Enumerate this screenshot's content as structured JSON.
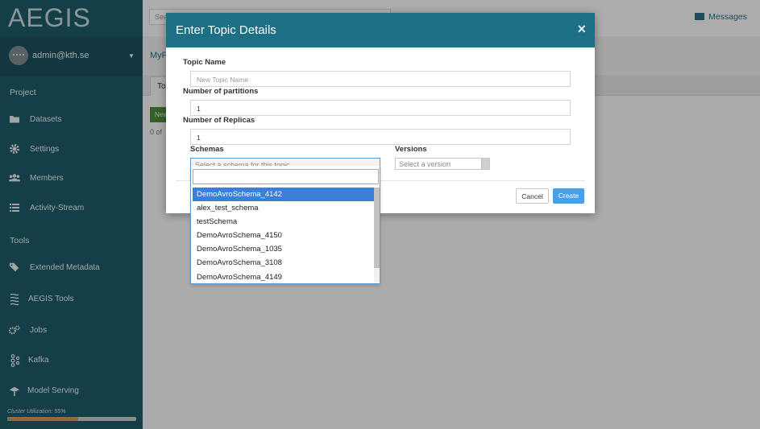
{
  "sidebar": {
    "brand": "AEGIS",
    "user": "admin@kth.se",
    "project_section": "Project",
    "project_items": [
      {
        "label": "Datasets",
        "icon": "folder-icon"
      },
      {
        "label": "Settings",
        "icon": "gear-icon"
      },
      {
        "label": "Members",
        "icon": "users-icon"
      },
      {
        "label": "Activity-Stream",
        "icon": "list-icon"
      }
    ],
    "tools_section": "Tools",
    "tools_items": [
      {
        "label": "Extended Metadata",
        "icon": "tags-icon"
      },
      {
        "label": "AEGIS Tools",
        "icon": "aegis-icon"
      },
      {
        "label": "Jobs",
        "icon": "cogs-icon"
      },
      {
        "label": "Kafka",
        "icon": "kafka-icon"
      },
      {
        "label": "Model Serving",
        "icon": "serving-icon"
      }
    ],
    "cluster_utilization": "Cluster Utilization: 55%",
    "cluster_utilization_value": 0.55
  },
  "page": {
    "search_placeholder": "Sea",
    "messages": "Messages",
    "crumb": "MyP",
    "tab": "To",
    "new_button": "New",
    "count": "0 of"
  },
  "modal": {
    "title": "Enter Topic Details",
    "close": "×",
    "topic_name_label": "Topic Name",
    "topic_name_placeholder": "New Topic Name",
    "partitions_label": "Number of partitions",
    "partitions_value": "1",
    "replicas_label": "Number of Replicas",
    "replicas_value": "1",
    "schemas_label": "Schemas",
    "schema_placeholder": "Select a schema for this topic",
    "versions_label": "Versions",
    "version_placeholder": "Select a version",
    "cancel": "Cancel",
    "create": "Create"
  },
  "dropdown": {
    "items": [
      "DemoAvroSchema_4142",
      "alex_test_schema",
      "testSchema",
      "DemoAvroSchema_4150",
      "DemoAvroSchema_1035",
      "DemoAvroSchema_3108",
      "DemoAvroSchema_4149"
    ],
    "selected_index": 0
  },
  "colors": {
    "sidebar_bg": "#1e5a68",
    "modal_header": "#1d6f85",
    "primary_button": "#4aa0e8",
    "selected_item": "#3b7fd8"
  }
}
